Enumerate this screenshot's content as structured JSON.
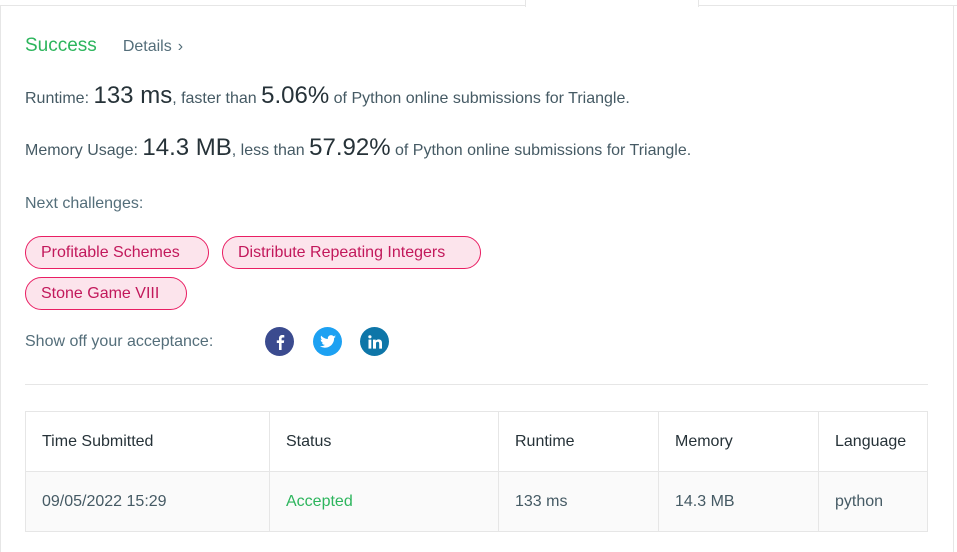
{
  "result": {
    "status": "Success",
    "details_label": "Details",
    "details_chevron": "›"
  },
  "runtime": {
    "label": "Runtime:",
    "value": "133 ms",
    "mid_text": ", faster than",
    "percent": "5.06%",
    "tail_text": "of Python online submissions for Triangle."
  },
  "memory": {
    "label": "Memory Usage:",
    "value": "14.3 MB",
    "mid_text": ", less than",
    "percent": "57.92%",
    "tail_text": "of Python online submissions for Triangle."
  },
  "next": {
    "label": "Next challenges:",
    "challenges": [
      "Profitable Schemes",
      "Distribute Repeating Integers",
      "Stone Game VIII"
    ]
  },
  "share": {
    "label": "Show off your acceptance:",
    "icons": [
      "facebook-icon",
      "twitter-icon",
      "linkedin-icon"
    ]
  },
  "submissions": {
    "headers": [
      "Time Submitted",
      "Status",
      "Runtime",
      "Memory",
      "Language"
    ],
    "rows": [
      [
        "09/05/2022 15:29",
        "Accepted",
        "133 ms",
        "14.3 MB",
        "python"
      ]
    ]
  },
  "colors": {
    "success": "#2db55d",
    "chip_border": "#e91e63",
    "chip_bg": "#fce4ec",
    "facebook": "#3b4b8f",
    "twitter": "#1da1f2",
    "linkedin": "#0e76a8"
  }
}
